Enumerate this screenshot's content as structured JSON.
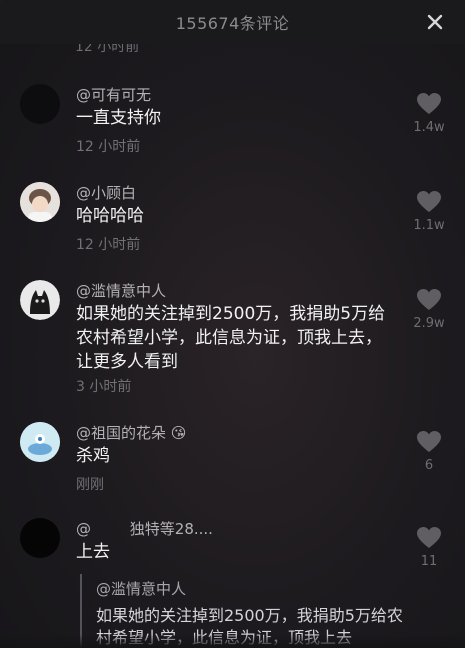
{
  "header": {
    "title": "155674条评论"
  },
  "partial_timestamp": "12 小时前",
  "comments": [
    {
      "user": "@可有可无",
      "text": "一直支持你",
      "time": "12 小时前",
      "likes": "1.4w",
      "avatar_color": "#0d0d0f"
    },
    {
      "user": "@小顾白",
      "text": "哈哈哈哈",
      "time": "12 小时前",
      "likes": "1.1w",
      "avatar_color": "#d9d4cf"
    },
    {
      "user": "@滥情意中人",
      "text": "如果她的关注掉到2500万，我捐助5万给农村希望小学，此信息为证，顶我上去，让更多人看到",
      "time": "3 小时前",
      "likes": "2.9w",
      "avatar_color": "#222"
    },
    {
      "user": "@祖国的花朵",
      "emoji": "😘",
      "text": "杀鸡",
      "time": "刚刚",
      "likes": "6",
      "avatar_color": "#bfe3ee"
    },
    {
      "user": "@",
      "user_suffix": "独特等28....",
      "text": "上去",
      "likes": "11",
      "avatar_color": "#050505",
      "reply_to": {
        "user": "@滥情意中人",
        "text": "如果她的关注掉到2500万，我捐助5万给农村希望小学，此信息为证，顶我上去"
      }
    }
  ]
}
